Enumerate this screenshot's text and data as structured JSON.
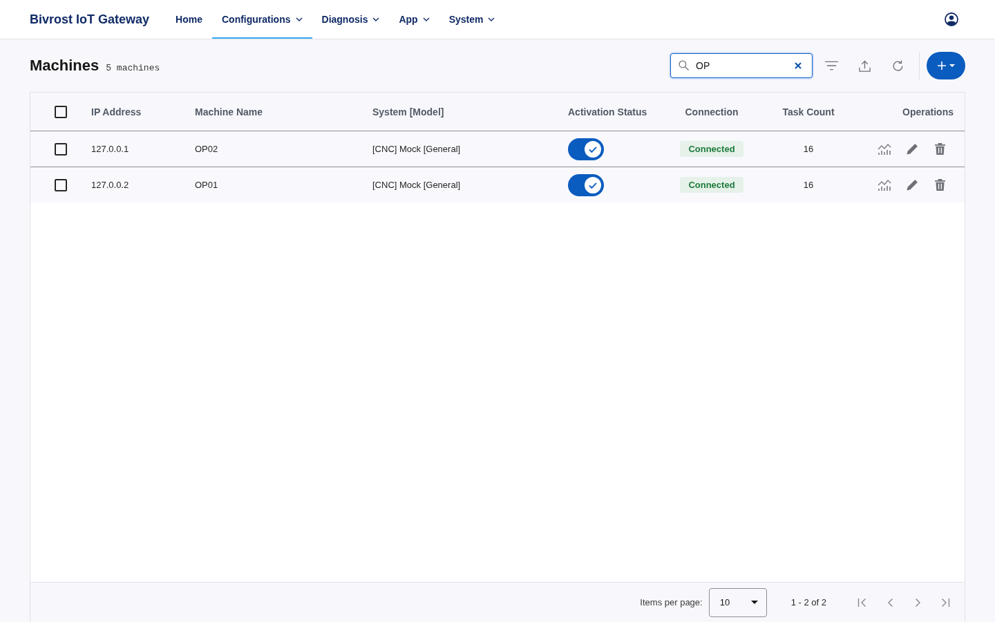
{
  "header": {
    "brand": "Bivrost IoT Gateway",
    "nav": [
      {
        "label": "Home",
        "has_menu": false,
        "selected": false
      },
      {
        "label": "Configurations",
        "has_menu": true,
        "selected": true
      },
      {
        "label": "Diagnosis",
        "has_menu": true,
        "selected": false
      },
      {
        "label": "App",
        "has_menu": true,
        "selected": false
      },
      {
        "label": "System",
        "has_menu": true,
        "selected": false
      }
    ]
  },
  "page": {
    "title": "Machines",
    "count": "5 machines"
  },
  "search": {
    "value": "OP"
  },
  "table": {
    "select_all": {
      "checked": false
    },
    "columns": [
      "IP Address",
      "Machine Name",
      "System [Model]",
      "Activation Status",
      "Connection",
      "Task Count",
      "Operations"
    ],
    "rows": [
      {
        "checked": false,
        "ip": "127.0.0.1",
        "name": "OP02",
        "system": "[CNC] Mock [General]",
        "active": true,
        "connection": "Connected",
        "connected": true,
        "task_count": "16"
      },
      {
        "checked": false,
        "ip": "127.0.0.2",
        "name": "OP01",
        "system": "[CNC] Mock [General]",
        "active": true,
        "connection": "Connected",
        "connected": true,
        "task_count": "16"
      }
    ]
  },
  "pagination": {
    "label": "Items per page:",
    "page_size": "10",
    "range": "1 - 2 of 2"
  }
}
